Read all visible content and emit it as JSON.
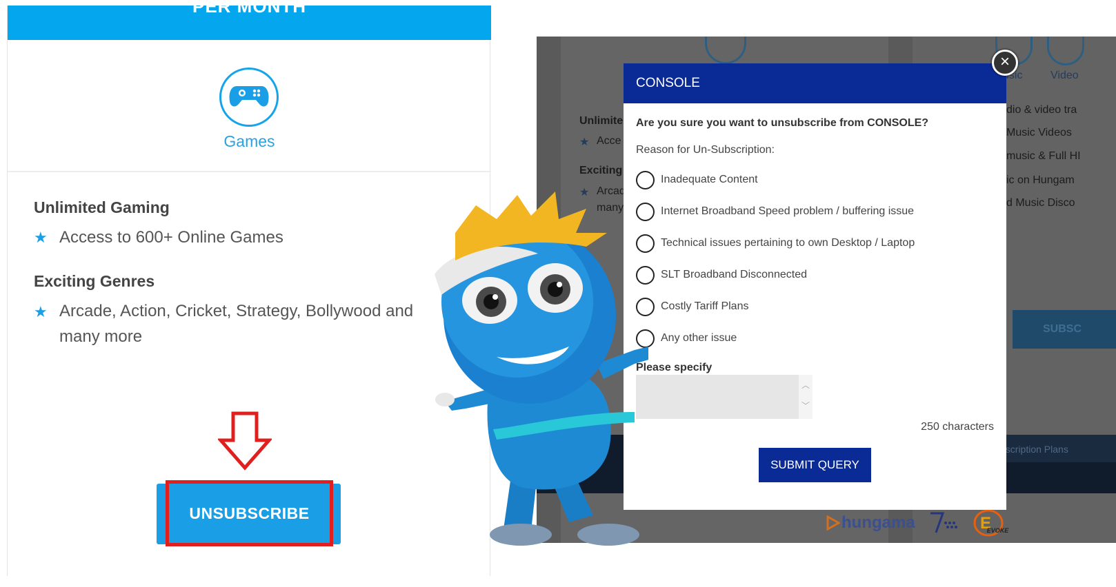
{
  "left": {
    "banner_text": "PER MONTH",
    "games_label": "Games",
    "section1_title": "Unlimited Gaming",
    "section1_item": "Access to 600+ Online Games",
    "section2_title": "Exciting Genres",
    "section2_item": "Arcade, Action, Cricket, Strategy, Bollywood and many more",
    "unsubscribe_label": "UNSUBSCRIBE"
  },
  "background": {
    "col1_head1": "Unlimite",
    "col1_item1": "Acce",
    "col1_head2": "Exciting",
    "col1_item2a": "Arcad",
    "col1_item2b": "many",
    "tab_music": "usic",
    "tab_video": "Video",
    "col2_line1": "dio & video tra",
    "col2_line2": "Music Videos",
    "col2_line3": "music & Full HI",
    "col2_line4": "ic on Hungam",
    "col2_line5": "d Music Disco",
    "subscribe_partial": "SUBSC",
    "subscription_plans": "bscription Plans",
    "logo_hungama": "hungama",
    "logo_evoke": "EVOKE"
  },
  "modal": {
    "title": "CONSOLE",
    "close_symbol": "×",
    "question": "Are you sure you want to unsubscribe from CONSOLE?",
    "reason_label": "Reason for Un-Subscription:",
    "options": [
      "Inadequate Content",
      "Internet Broadband Speed problem / buffering issue",
      "Technical issues pertaining to own Desktop / Laptop",
      "SLT Broadband Disconnected",
      "Costly Tariff Plans",
      "Any other issue"
    ],
    "specify_label": "Please specify",
    "char_count": "250 characters",
    "submit_label": "SUBMIT QUERY"
  },
  "colors": {
    "accent_blue": "#04a7ee",
    "modal_blue": "#0a2a96",
    "highlight_red": "#e0201f"
  }
}
